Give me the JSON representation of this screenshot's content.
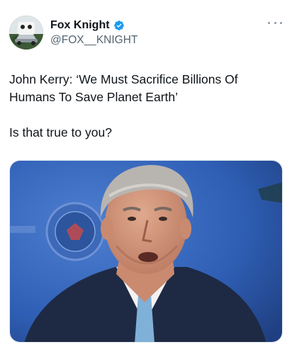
{
  "tweet": {
    "author_name": "Fox Knight",
    "author_handle": "@FOX__KNIGHT",
    "verified_icon": "verified-badge-icon",
    "more_icon": "more-options-icon",
    "paragraphs": [
      "John Kerry: ‘We Must Sacrifice Billions Of Humans To Save Planet Earth’",
      "Is that true to you?"
    ],
    "media": {
      "type": "photo"
    }
  },
  "colors": {
    "verified_blue": "#1d9bf0",
    "text_primary": "#0f1419",
    "text_secondary": "#536471",
    "media_background": "#2f5fb5"
  }
}
